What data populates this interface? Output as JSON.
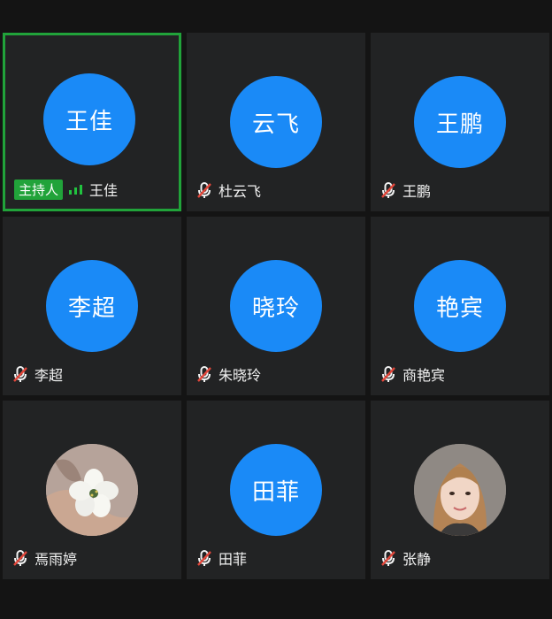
{
  "participants": [
    {
      "avatar_text": "王佳",
      "name": "王佳",
      "role": "主持人",
      "mic": "active",
      "highlighted": true
    },
    {
      "avatar_text": "云飞",
      "name": "杜云飞",
      "mic": "muted"
    },
    {
      "avatar_text": "王鹏",
      "name": "王鹏",
      "mic": "muted"
    },
    {
      "avatar_text": "李超",
      "name": "李超",
      "mic": "muted"
    },
    {
      "avatar_text": "晓玲",
      "name": "朱晓玲",
      "mic": "muted"
    },
    {
      "avatar_text": "艳宾",
      "name": "商艳宾",
      "mic": "muted"
    },
    {
      "avatar_text": "",
      "name": "焉雨婷",
      "mic": "muted",
      "avatar": "photo-flower"
    },
    {
      "avatar_text": "田菲",
      "name": "田菲",
      "mic": "muted"
    },
    {
      "avatar_text": "",
      "name": "张静",
      "mic": "muted",
      "avatar": "photo-portrait"
    }
  ],
  "colors": {
    "avatar": "#1a8af7",
    "active_border": "#21a33a",
    "host_badge": "#21a33a",
    "tile_bg": "#222324",
    "muted_slash": "#e3473b"
  }
}
